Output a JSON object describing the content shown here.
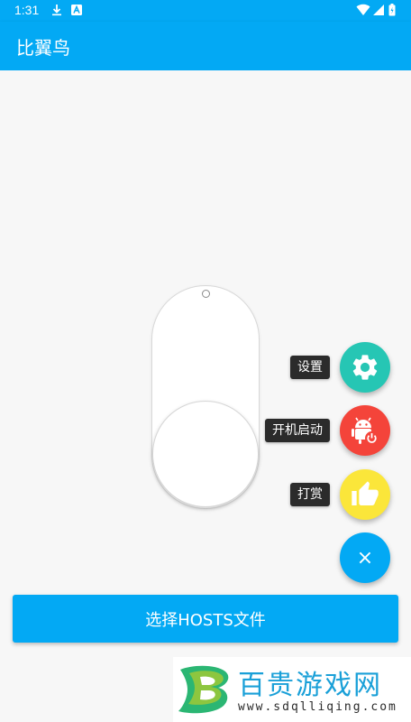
{
  "status_bar": {
    "time": "1:31",
    "left_icons": [
      "download-icon",
      "app-notification-icon"
    ],
    "right_icons": [
      "wifi-icon",
      "signal-icon",
      "battery-icon"
    ]
  },
  "app_bar": {
    "title": "比翼鸟"
  },
  "toggle": {
    "state": "off"
  },
  "fab_menu": {
    "items": [
      {
        "label": "设置",
        "icon": "gear-icon",
        "color": "#26c6b4"
      },
      {
        "label": "开机启动",
        "icon": "android-power-icon",
        "color": "#f4443a"
      },
      {
        "label": "打赏",
        "icon": "thumbs-up-icon",
        "color": "#fbe63a"
      }
    ],
    "close": {
      "label": "×",
      "color": "#03a9f4"
    }
  },
  "main_button": {
    "label": "选择HOSTS文件"
  },
  "watermark": {
    "title": "百贵游戏网",
    "url": "www.sdqlliqing.com"
  },
  "colors": {
    "primary": "#03a9f4",
    "background": "#f7f7f7"
  }
}
